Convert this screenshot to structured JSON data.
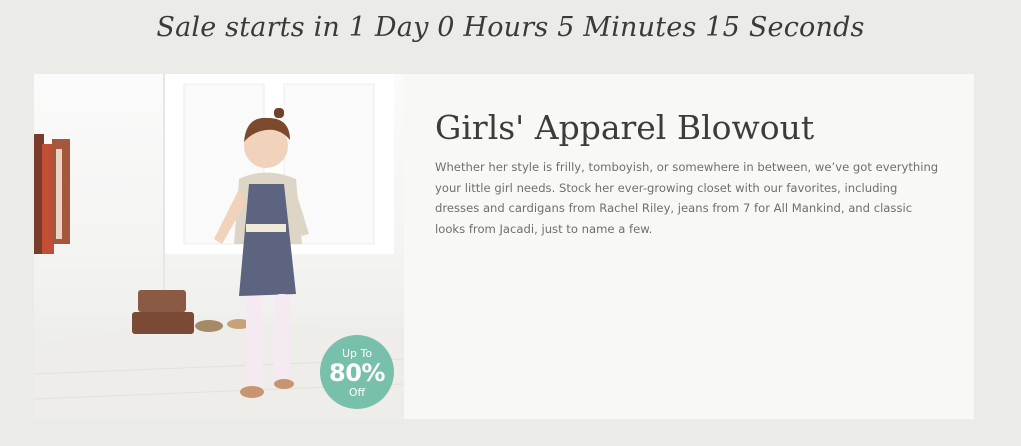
{
  "countdown": {
    "text": "Sale starts in 1 Day 0 Hours 5 Minutes 15 Seconds"
  },
  "sale": {
    "title": "Girls' Apparel Blowout",
    "description": "Whether her style is frilly, tomboyish, or somewhere in between, we’ve got everything your little girl needs. Stock her ever-growing closet with our favorites, including dresses and cardigans from Rachel Riley, jeans from 7 for All Mankind, and classic looks from Jacadi, just to name a few.",
    "badge": {
      "line1": "Up To",
      "line2": "80%",
      "line3": "Off",
      "color": "#79c0ac"
    }
  }
}
